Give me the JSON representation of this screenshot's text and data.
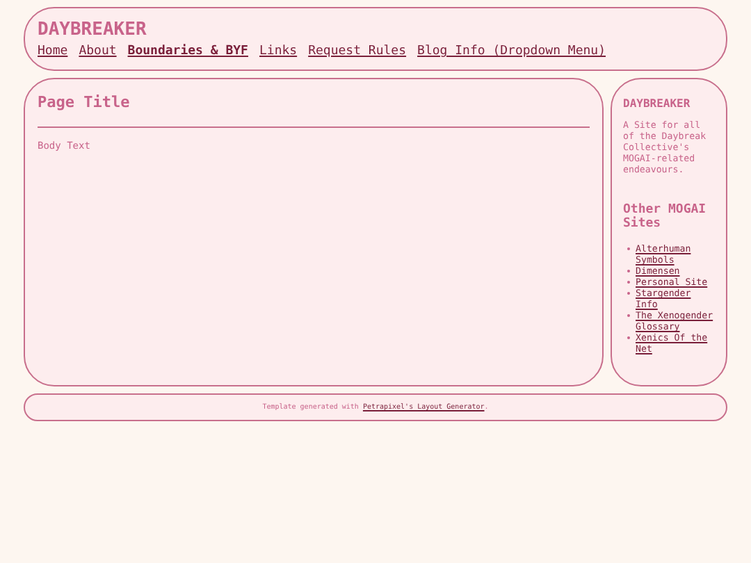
{
  "header": {
    "title": "DAYBREAKER",
    "nav": [
      {
        "label": "Home",
        "selected": false
      },
      {
        "label": "About",
        "selected": false
      },
      {
        "label": "Boundaries & BYF",
        "selected": true
      },
      {
        "label": "Links",
        "selected": false
      },
      {
        "label": "Request Rules",
        "selected": false
      },
      {
        "label": "Blog Info (Dropdown Menu)",
        "selected": false
      }
    ]
  },
  "main": {
    "title": "Page Title",
    "body": "Body Text"
  },
  "sidebar": {
    "title": "DAYBREAKER",
    "description": "A Site for all of the Daybreak Collective's MOGAI-related endeavours.",
    "links_heading": "Other MOGAI Sites",
    "links": [
      "Alterhuman Symbols",
      "Dimensen",
      "Personal Site",
      "Stargender Info",
      "The Xenogender Glossary",
      "Xenics Of the Net"
    ]
  },
  "footer": {
    "text": "Template generated with ",
    "link": "Petrapixel's Layout Generator",
    "suffix": "."
  }
}
